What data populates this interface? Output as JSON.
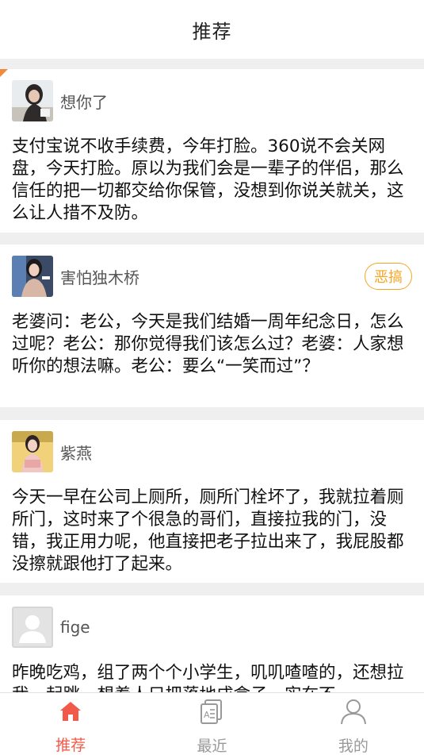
{
  "header": {
    "title": "推荐"
  },
  "posts": [
    {
      "author": "想你了",
      "content": "支付宝说不收手续费，今年打脸。360说不会关网盘，今天打脸。原以为我们会是一辈子的伴侣，那么信任的把一切都交给你保管，没想到你说关就关，这么让人措不及防。",
      "avatar_icon": "girl-photo-avatar"
    },
    {
      "author": "害怕独木桥",
      "tag": "恶搞",
      "content": "老婆问：老公，今天是我们结婚一周年纪念日，怎么过呢？老公：那你觉得我们该怎么过？老婆：人家想听你的想法嘛。老公：要么“一笑而过”？",
      "avatar_icon": "girl-photo-avatar"
    },
    {
      "author": "紫燕",
      "content": "今天一早在公司上厕所，厕所门栓坏了，我就拉着厕所门，这时来了个很急的哥们，直接拉我的门，没错，我正用力呢，他直接把老子拉出来了，我屁股都没擦就跟他打了起来。",
      "avatar_icon": "girl-photo-avatar"
    },
    {
      "author": "fige",
      "content": "昨晚吃鸡，组了两个个小学生，叽叽喳喳的，还想拉我一起跳，想着人只把落地成盒子，实在不",
      "avatar_icon": "default-user-avatar"
    }
  ],
  "tabbar": {
    "items": [
      {
        "label": "推荐",
        "icon": "home-icon",
        "active": true
      },
      {
        "label": "最近",
        "icon": "document-icon",
        "active": false
      },
      {
        "label": "我的",
        "icon": "person-icon",
        "active": false
      }
    ],
    "active_color": "#f15a4a",
    "inactive_color": "#999999"
  },
  "colors": {
    "tag": "#f5a623",
    "divider": "#efefef",
    "accent": "#f08a3c"
  }
}
